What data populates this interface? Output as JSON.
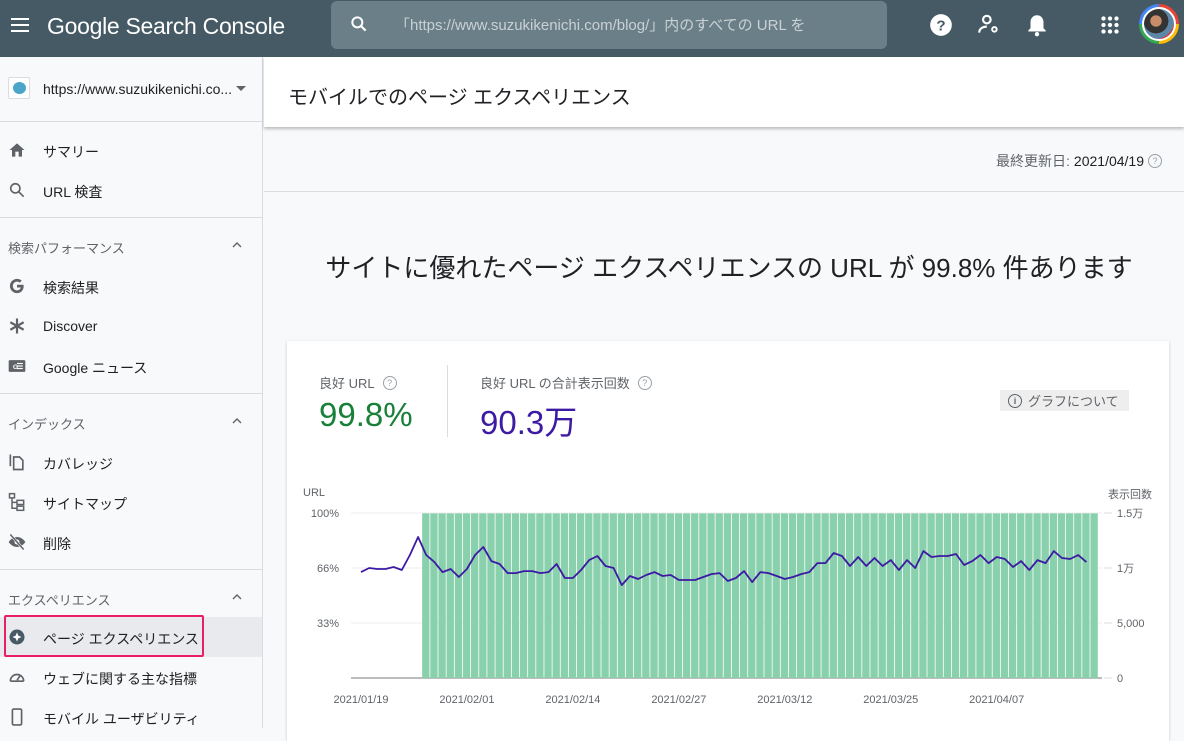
{
  "topbar": {
    "app_title_google": "Google",
    "app_title_rest": "Search Console",
    "search_placeholder": "「https://www.suzukikenichi.com/blog/」内のすべての URL を",
    "icons": [
      "menu-icon",
      "search-icon",
      "help-icon",
      "manage-users-icon",
      "notifications-icon",
      "apps-icon",
      "account-avatar"
    ]
  },
  "sidebar": {
    "property": "https://www.suzukikenichi.co...",
    "items_top": [
      {
        "label": "サマリー",
        "icon": "home-icon"
      },
      {
        "label": "URL 検査",
        "icon": "search-icon"
      }
    ],
    "sections": [
      {
        "title": "検索パフォーマンス",
        "items": [
          {
            "label": "検索結果",
            "icon": "google-g-icon"
          },
          {
            "label": "Discover",
            "icon": "asterisk-icon"
          },
          {
            "label": "Google ニュース",
            "icon": "news-icon"
          }
        ]
      },
      {
        "title": "インデックス",
        "items": [
          {
            "label": "カバレッジ",
            "icon": "copy-icon"
          },
          {
            "label": "サイトマップ",
            "icon": "sitemap-icon"
          },
          {
            "label": "削除",
            "icon": "visibility-off-icon"
          }
        ]
      },
      {
        "title": "エクスペリエンス",
        "items": [
          {
            "label": "ページ エクスペリエンス",
            "icon": "page-experience-icon",
            "active": true
          },
          {
            "label": "ウェブに関する主な指標",
            "icon": "speed-icon"
          },
          {
            "label": "モバイル ユーザビリティ",
            "icon": "smartphone-icon"
          }
        ]
      }
    ]
  },
  "page": {
    "title": "モバイルでのページ エクスペリエンス",
    "last_updated_label": "最終更新日:",
    "last_updated_value": "2021/04/19",
    "headline": "サイトに優れたページ エクスペリエンスの URL が 99.8% 件あります"
  },
  "card": {
    "metric_good_url_label": "良好 URL",
    "metric_good_url_value": "99.8%",
    "metric_impressions_label": "良好 URL の合計表示回数",
    "metric_impressions_value": "90.3万",
    "about_graph_label": "グラフについて",
    "colors": {
      "bar": "#89d0ad",
      "line": "#3d1aa3",
      "good": "#188038"
    }
  },
  "chart_data": {
    "type": "bar",
    "ylabel_left": "URL",
    "ylabel_right": "表示回数",
    "left_ticks": [
      "100%",
      "66%",
      "33%"
    ],
    "left_ylim": [
      0,
      100
    ],
    "right_ticks": [
      "1.5万",
      "1万",
      "5,000",
      "0"
    ],
    "right_ylim": [
      0,
      15000
    ],
    "x_tick_labels": [
      "2021/01/19",
      "2021/02/01",
      "2021/02/14",
      "2021/02/27",
      "2021/03/12",
      "2021/03/25",
      "2021/04/07"
    ],
    "start_date": "2021/01/19",
    "bar_start_date": "2021/01/27",
    "bar_end_date": "2021/04/19",
    "series": [
      {
        "name": "良好 URL (%)",
        "axis": "left",
        "kind": "bar",
        "value_per_day": 99.8,
        "days": 83
      },
      {
        "name": "表示回数",
        "axis": "right",
        "kind": "line",
        "values": [
          9630,
          10000,
          9910,
          9910,
          10090,
          9820,
          11180,
          12820,
          11180,
          10540,
          9630,
          9910,
          9180,
          9910,
          11180,
          11910,
          10630,
          10360,
          9540,
          9540,
          9720,
          9720,
          9540,
          9630,
          10360,
          9090,
          9090,
          9820,
          10720,
          11090,
          10180,
          10000,
          8450,
          9270,
          9000,
          9360,
          9630,
          9270,
          9360,
          8910,
          8910,
          8910,
          9180,
          9450,
          9540,
          8820,
          9090,
          9720,
          8720,
          9630,
          9540,
          9270,
          9000,
          9180,
          9450,
          9630,
          10450,
          10450,
          11360,
          11090,
          10180,
          11000,
          10180,
          10910,
          10180,
          10720,
          9820,
          10720,
          10000,
          11540,
          11000,
          11090,
          11090,
          11270,
          10270,
          10630,
          11180,
          10450,
          11000,
          10820,
          10090,
          10630,
          9820,
          10720,
          10450,
          11540,
          10910,
          10820,
          11180,
          10540
        ]
      }
    ]
  }
}
